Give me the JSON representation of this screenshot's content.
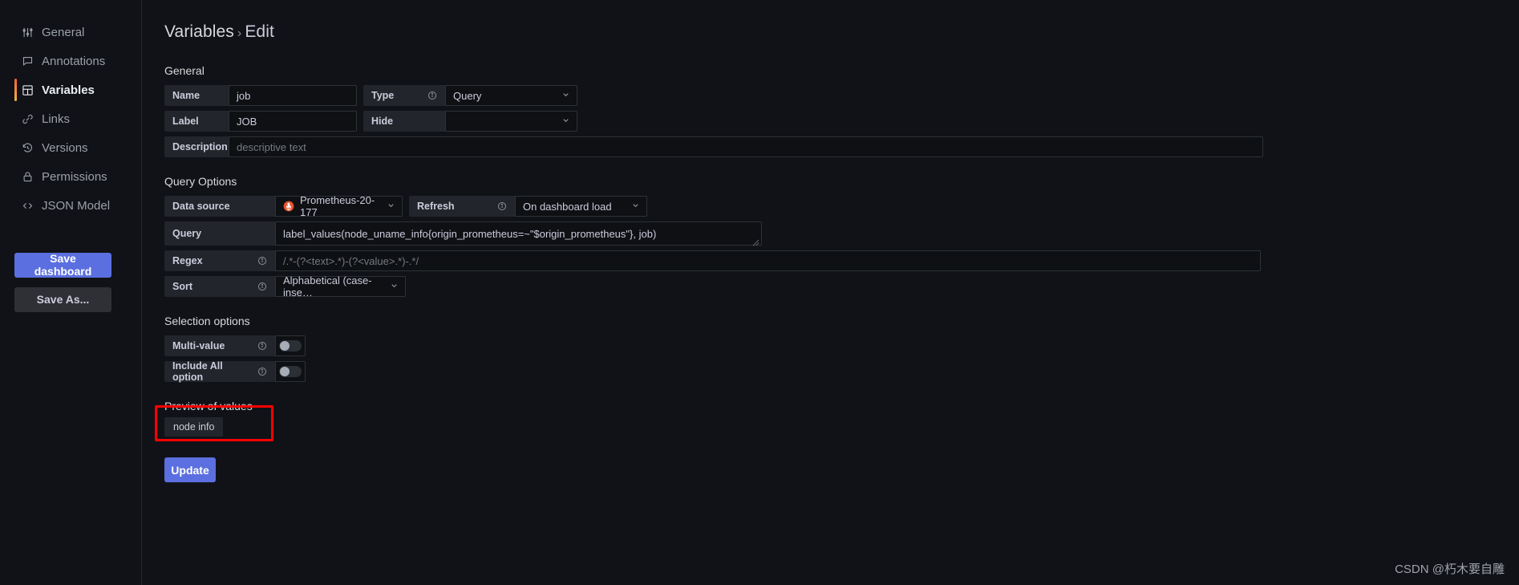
{
  "sidebar": {
    "items": [
      {
        "label": "General",
        "icon": "sliders-icon",
        "active": false
      },
      {
        "label": "Annotations",
        "icon": "comment-icon",
        "active": false
      },
      {
        "label": "Variables",
        "icon": "table-icon",
        "active": true
      },
      {
        "label": "Links",
        "icon": "link-icon",
        "active": false
      },
      {
        "label": "Versions",
        "icon": "history-icon",
        "active": false
      },
      {
        "label": "Permissions",
        "icon": "lock-icon",
        "active": false
      },
      {
        "label": "JSON Model",
        "icon": "code-icon",
        "active": false
      }
    ],
    "save_dashboard_label": "Save dashboard",
    "save_as_label": "Save As..."
  },
  "header": {
    "breadcrumb_root": "Variables",
    "breadcrumb_separator": "›",
    "breadcrumb_current": "Edit"
  },
  "general": {
    "section_label": "General",
    "name_label": "Name",
    "name_value": "job",
    "type_label": "Type",
    "type_value": "Query",
    "label_label": "Label",
    "label_value": "JOB",
    "hide_label": "Hide",
    "hide_value": "",
    "description_label": "Description",
    "description_placeholder": "descriptive text"
  },
  "query_options": {
    "section_label": "Query Options",
    "datasource_label": "Data source",
    "datasource_value": "Prometheus-20-177",
    "refresh_label": "Refresh",
    "refresh_value": "On dashboard load",
    "query_label": "Query",
    "query_value": "label_values(node_uname_info{origin_prometheus=~\"$origin_prometheus\"}, job)",
    "regex_label": "Regex",
    "regex_placeholder": "/.*-(?<text>.*)-(?<value>.*)-.*/",
    "sort_label": "Sort",
    "sort_value": "Alphabetical (case-inse…"
  },
  "selection_options": {
    "section_label": "Selection options",
    "multi_value_label": "Multi-value",
    "multi_value_on": false,
    "include_all_label": "Include All option",
    "include_all_on": false
  },
  "preview": {
    "title": "Preview of values",
    "values": [
      "node info"
    ]
  },
  "footer": {
    "update_label": "Update"
  },
  "watermark": {
    "text": "CSDN @朽木要自雕"
  },
  "colors": {
    "accent_primary": "#5b6fe0",
    "highlight_box": "#fe0000",
    "active_nav_gradient_start": "#f55f3e",
    "active_nav_gradient_end": "#f5b73d",
    "prometheus_orange": "#e6522c",
    "panel_bg": "#111217",
    "input_bg": "#0e1014",
    "label_bg": "#22252b"
  }
}
